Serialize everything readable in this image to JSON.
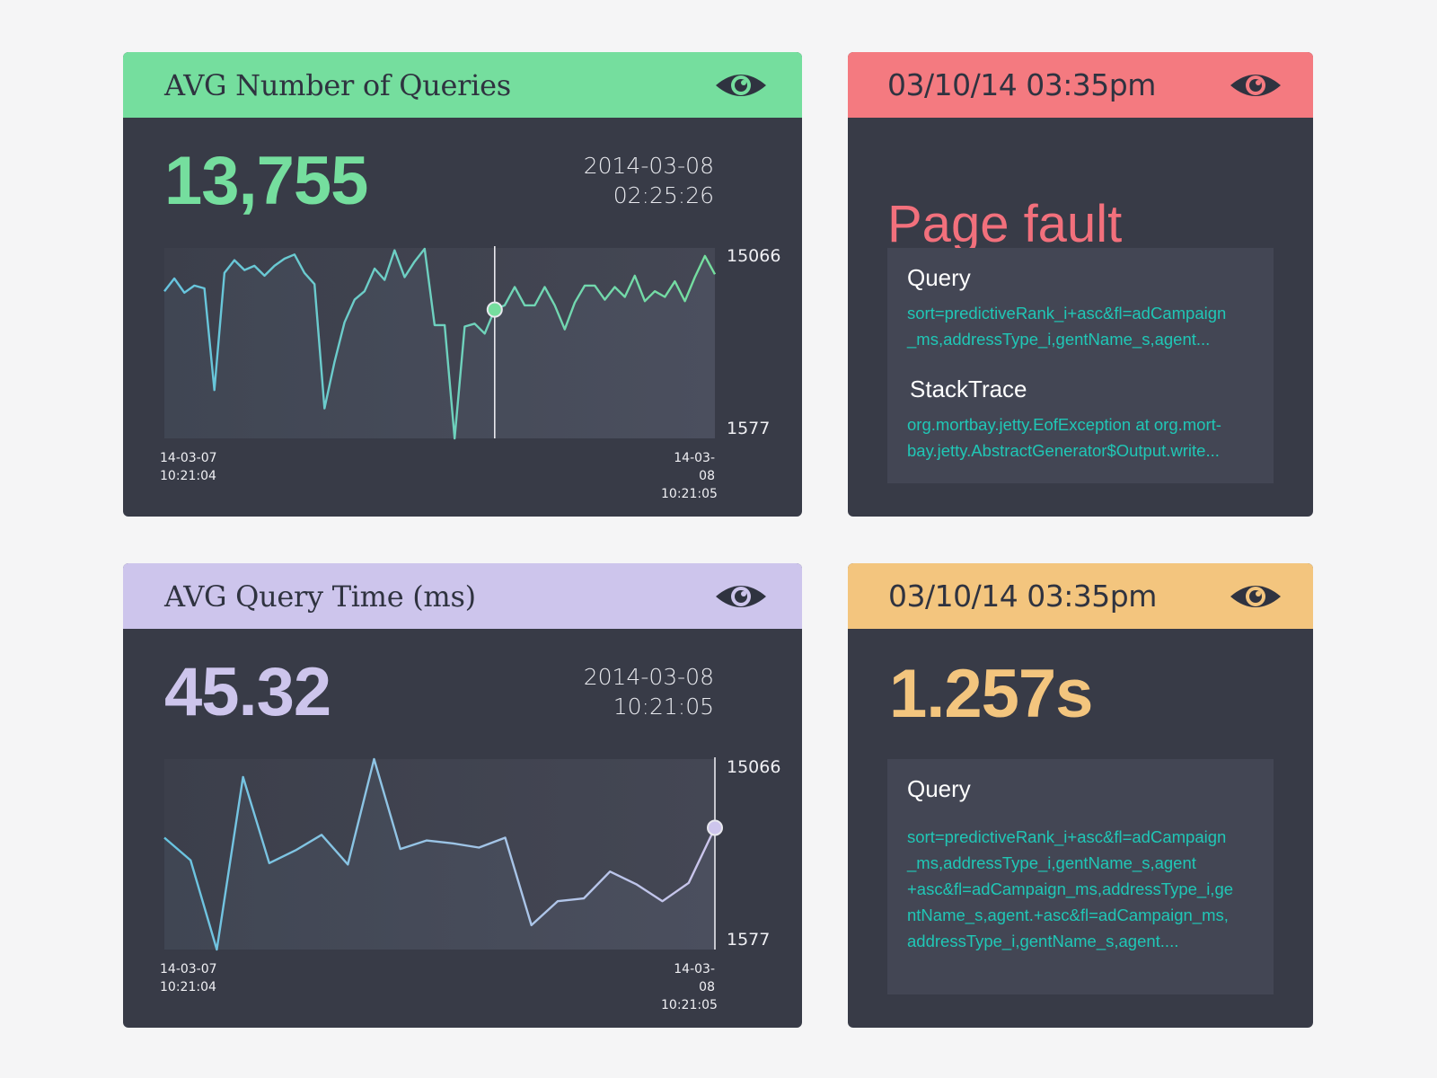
{
  "colors": {
    "green": "#75de9e",
    "red": "#f47a80",
    "purple": "#cdc5ec",
    "orange": "#f3c57e",
    "card_bg": "#383b47",
    "teal_text": "#20c7b6"
  },
  "cards": {
    "queries": {
      "title": "AVG Number of Queries",
      "value": "13,755",
      "date": "2014-03-08",
      "time": "02:25:26",
      "y_max_label": "15066",
      "y_min_label": "1577",
      "x_start_date": "14-03-07",
      "x_start_time": "10:21:04",
      "x_end_date": "14-03-08",
      "x_end_time": "10:21:05",
      "icon": "eye-icon"
    },
    "query_time": {
      "title": "AVG Query Time (ms)",
      "value": "45.32",
      "date": "2014-03-08",
      "time": "10:21:05",
      "y_max_label": "15066",
      "y_min_label": "1577",
      "x_start_date": "14-03-07",
      "x_start_time": "10:21:04",
      "x_end_date": "14-03-08",
      "x_end_time": "10:21:05",
      "icon": "eye-icon"
    },
    "page_fault": {
      "header": "03/10/14 03:35pm",
      "title": "Page fault",
      "query_label": "Query",
      "query_lines": [
        "sort=predictiveRank_i+asc&fl=adCampaign",
        "_ms,addressType_i,gentName_s,agent..."
      ],
      "stack_label": "StackTrace",
      "stack_lines": [
        "org.mortbay.jetty.EofException at org.mort-",
        "bay.jetty.AbstractGenerator$Output.write..."
      ],
      "icon": "eye-icon"
    },
    "slow_query": {
      "header": "03/10/14 03:35pm",
      "value": "1.257s",
      "query_label": "Query",
      "query_lines": [
        "sort=predictiveRank_i+asc&fl=adCampaign",
        "_ms,addressType_i,gentName_s,agent",
        "+asc&fl=adCampaign_ms,addressType_i,ge",
        "ntName_s,agent.+asc&fl=adCampaign_ms,",
        "addressType_i,gentName_s,agent...."
      ],
      "icon": "eye-icon"
    }
  },
  "chart_data": [
    {
      "type": "line",
      "title": "AVG Number of Queries",
      "ylim": [
        1577,
        15066
      ],
      "y_tick_labels": [
        "15066",
        "1577"
      ],
      "x_tick_labels": [
        "14-03-07 10:21:04",
        "14-03-08 10:21:05"
      ],
      "values": [
        12000,
        12900,
        11900,
        12400,
        12200,
        5000,
        13300,
        14200,
        13500,
        13800,
        13100,
        13800,
        14300,
        14600,
        13300,
        12500,
        3700,
        7000,
        9800,
        11400,
        12000,
        13600,
        12800,
        14900,
        13000,
        14100,
        15000,
        9600,
        9600,
        1577,
        9500,
        9700,
        9000,
        10700,
        11000,
        12300,
        11000,
        11000,
        12300,
        11000,
        9300,
        11200,
        12400,
        12400,
        11400,
        12300,
        11600,
        13100,
        11300,
        12000,
        11600,
        12700,
        11300,
        13000,
        14500,
        13200
      ],
      "highlight_index": 33,
      "highlight_value": 10700,
      "line_colors": [
        "#67c4e0",
        "#75de9e"
      ]
    },
    {
      "type": "line",
      "title": "AVG Query Time (ms)",
      "ylim": [
        1577,
        15066
      ],
      "y_tick_labels": [
        "15066",
        "1577"
      ],
      "x_tick_labels": [
        "14-03-07 10:21:04",
        "14-03-08 10:21:05"
      ],
      "values": [
        9500,
        7900,
        1577,
        13800,
        7700,
        8600,
        9700,
        7600,
        15066,
        8700,
        9300,
        9100,
        8800,
        9500,
        3300,
        5000,
        5200,
        7100,
        6200,
        5000,
        6300,
        10200
      ],
      "highlight_index": 21,
      "highlight_value": 10200,
      "line_colors": [
        "#67c4e0",
        "#cdc5ec"
      ]
    }
  ]
}
